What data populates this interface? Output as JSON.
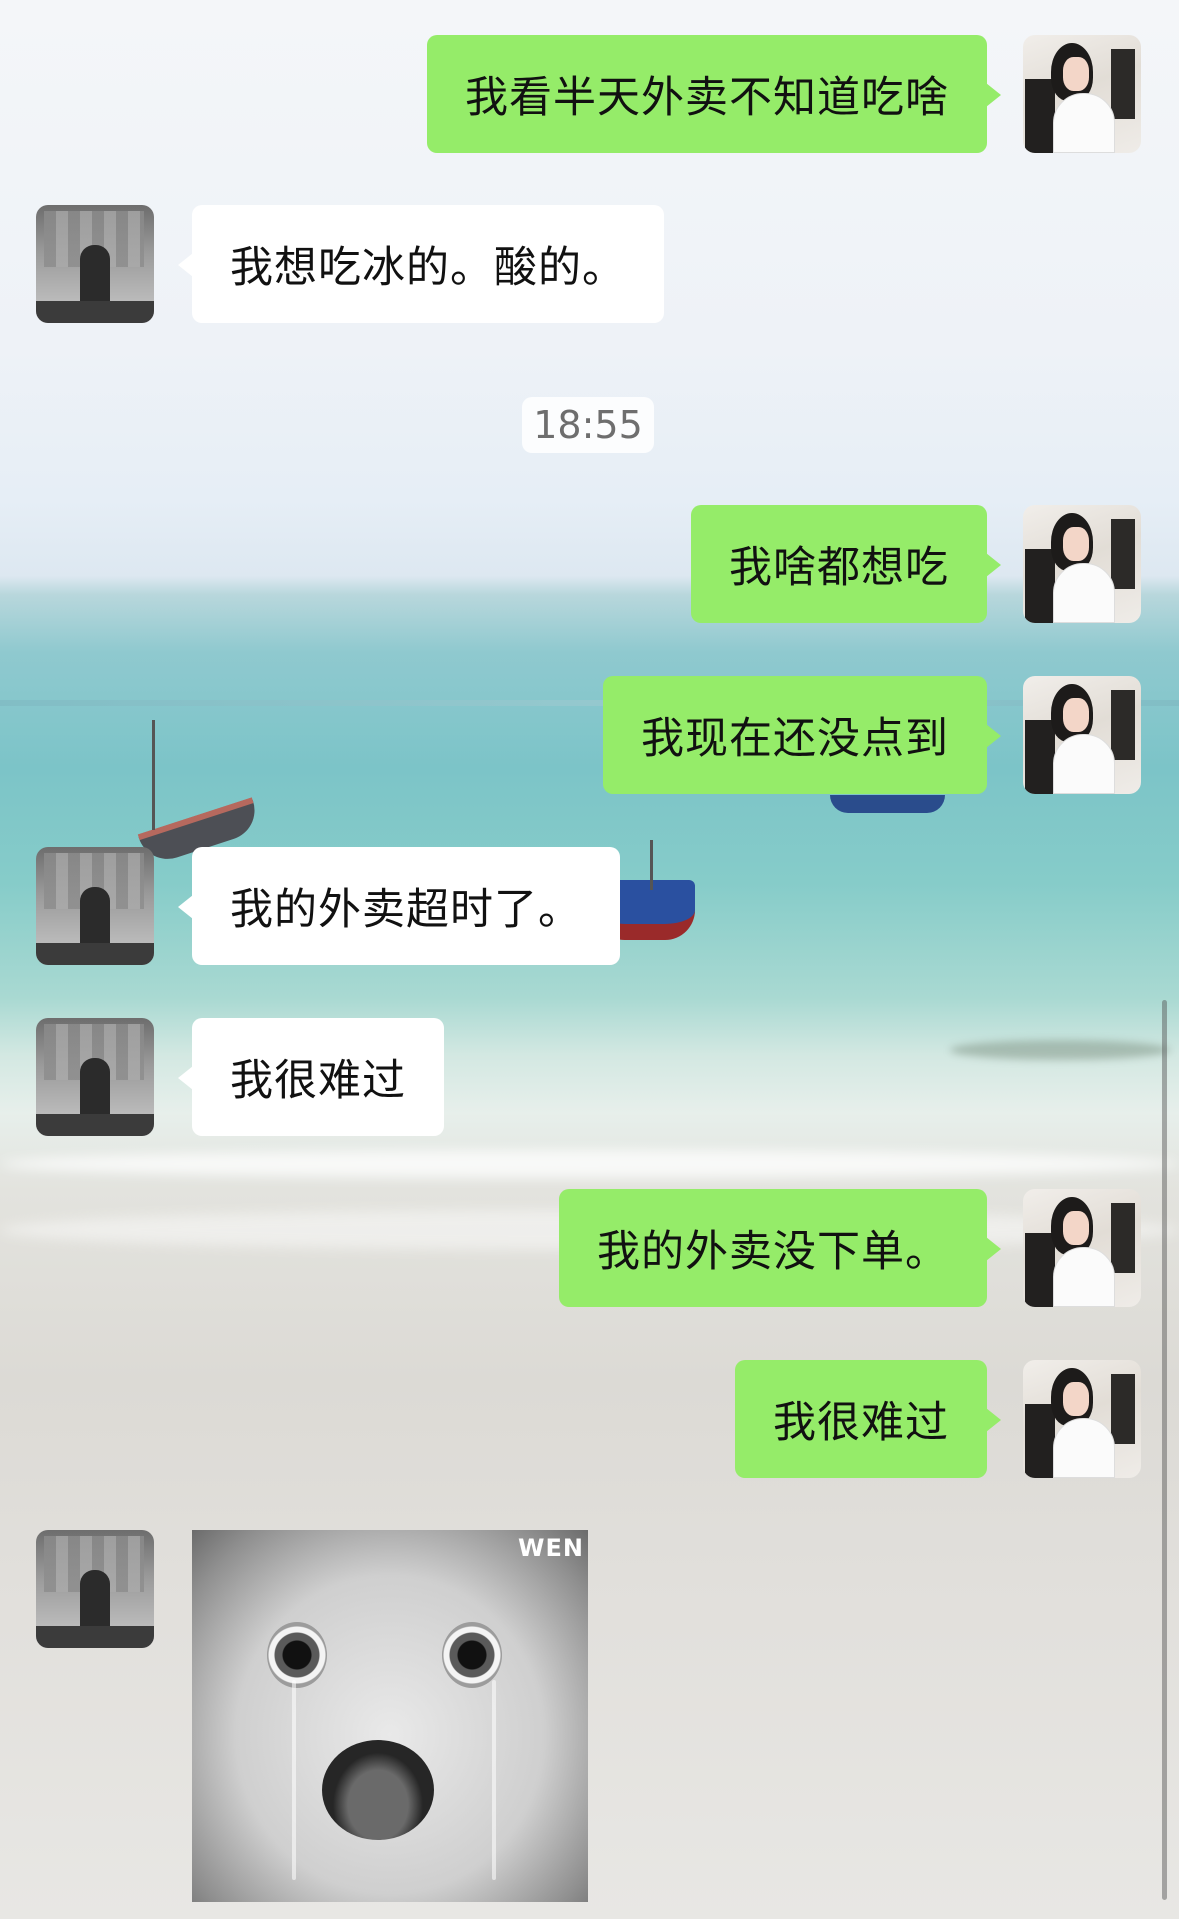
{
  "chat": {
    "messages": [
      {
        "sender": "me",
        "type": "text",
        "text": "我看半天外卖不知道吃啥"
      },
      {
        "sender": "peer",
        "type": "text",
        "text": "我想吃冰的。酸的。"
      },
      {
        "type": "time",
        "text": "18:55"
      },
      {
        "sender": "me",
        "type": "text",
        "text": "我啥都想吃"
      },
      {
        "sender": "me",
        "type": "text",
        "text": "我现在还没点到"
      },
      {
        "sender": "peer",
        "type": "text",
        "text": "我的外卖超时了。"
      },
      {
        "sender": "peer",
        "type": "text",
        "text": "我很难过"
      },
      {
        "sender": "me",
        "type": "text",
        "text": "我的外卖没下单。"
      },
      {
        "sender": "me",
        "type": "text",
        "text": "我很难过"
      },
      {
        "sender": "peer",
        "type": "sticker",
        "description": "crying-ghost-sticker",
        "watermark": "WEN"
      }
    ]
  },
  "colors": {
    "me_bubble": "#95ec69",
    "peer_bubble": "#ffffff",
    "time_text": "#6e6e6e"
  }
}
